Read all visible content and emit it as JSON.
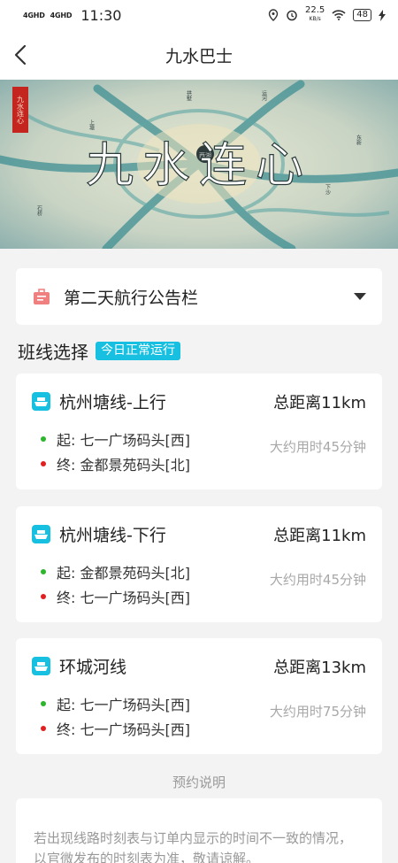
{
  "status_bar": {
    "network_1": "4GHD",
    "network_2": "4GHD",
    "time": "11:30",
    "speed_value": "22.5",
    "speed_unit": "KB/s",
    "battery": "48"
  },
  "nav": {
    "title": "九水巴士"
  },
  "banner": {
    "title": "九水连心",
    "seal": "九水连心",
    "center_label": "西湖",
    "places": [
      "拱墅",
      "运河",
      "上塘",
      "东新",
      "石桥",
      "下沙"
    ]
  },
  "notice": {
    "label": "第二天航行公告栏"
  },
  "routes_section": {
    "title": "班线选择",
    "status": "今日正常运行"
  },
  "routes": [
    {
      "name": "杭州塘线-上行",
      "distance": "总距离11km",
      "start": "起: 七一广场码头[西]",
      "end": "终: 金都景苑码头[北]",
      "duration": "大约用时45分钟"
    },
    {
      "name": "杭州塘线-下行",
      "distance": "总距离11km",
      "start": "起: 金都景苑码头[北]",
      "end": "终: 七一广场码头[西]",
      "duration": "大约用时45分钟"
    },
    {
      "name": "环城河线",
      "distance": "总距离13km",
      "start": "起: 七一广场码头[西]",
      "end": "终: 七一广场码头[西]",
      "duration": "大约用时75分钟"
    }
  ],
  "reservation": {
    "title": "预约说明",
    "text": "若出现线路时刻表与订单内显示的时间不一致的情况，以官微发布的时刻表为准，敬请谅解。"
  },
  "colors": {
    "accent": "#17bfe0",
    "start_dot": "#2db52d",
    "end_dot": "#e02020",
    "notice_icon": "#f07f7f"
  },
  "icons": [
    "back-arrow-icon",
    "notice-icon",
    "caret-down-icon",
    "boat-icon",
    "location-icon",
    "alarm-icon",
    "wifi-icon",
    "charging-icon"
  ]
}
